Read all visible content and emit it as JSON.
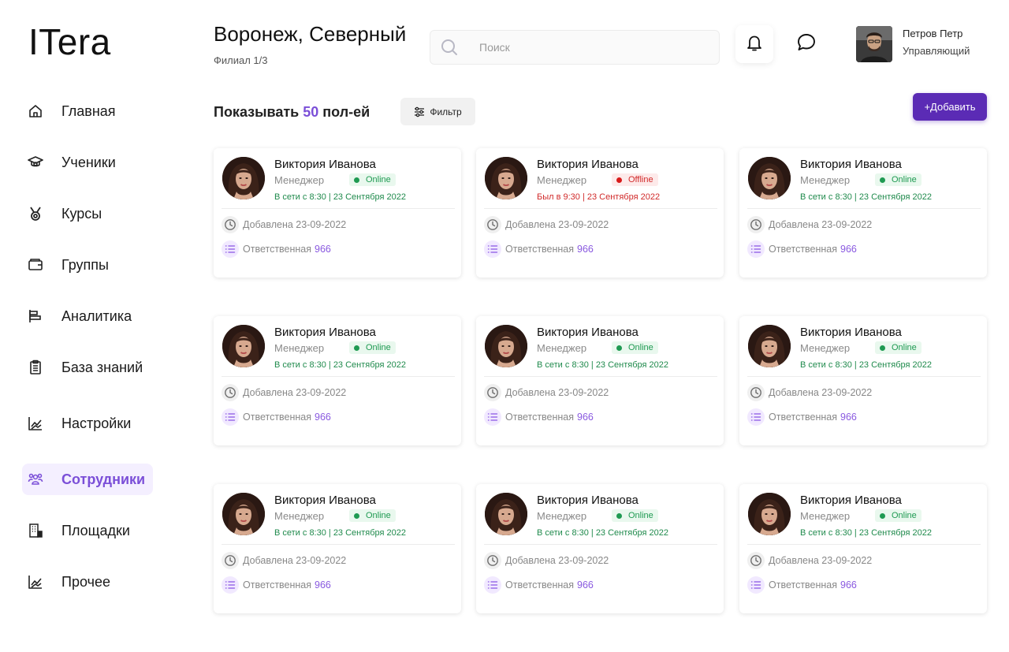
{
  "app": {
    "logo": "ITera"
  },
  "sidebar": {
    "items": [
      {
        "label": "Главная",
        "icon": "home-icon"
      },
      {
        "label": "Ученики",
        "icon": "graduation-cap-icon"
      },
      {
        "label": "Курсы",
        "icon": "medal-icon"
      },
      {
        "label": "Группы",
        "icon": "wallet-icon"
      },
      {
        "label": "Аналитика",
        "icon": "bar-chart-icon"
      },
      {
        "label": "База знаний",
        "icon": "clipboard-icon"
      },
      {
        "label": "Настройки",
        "icon": "line-chart-icon"
      },
      {
        "label": "Сотрудники",
        "icon": "people-icon",
        "active": true
      },
      {
        "label": "Площадки",
        "icon": "building-icon"
      },
      {
        "label": "Прочее",
        "icon": "line-chart-icon"
      }
    ]
  },
  "header": {
    "title": "Воронеж, Северный",
    "subtitle": "Филиал 1/3",
    "search_placeholder": "Поиск",
    "user": {
      "name": "Петров Петр",
      "role": "Управляющий"
    }
  },
  "toolbar": {
    "show_prefix": "Показывать",
    "show_count": "50",
    "show_suffix": "пол-ей",
    "filter_label": "Фильтр",
    "add_label": "+Добавить"
  },
  "colors": {
    "accent": "#7b4fd8",
    "add_button": "#5b2bb5",
    "online": "#1f9a52",
    "offline": "#d12a2a"
  },
  "cards": [
    {
      "name": "Виктория Иванова",
      "role": "Менеджер",
      "status": "Online",
      "status_kind": "online",
      "seen": "В сети с 8:30 | 23 Сентября 2022",
      "added": "Добавлена 23-09-2022",
      "resp_label": "Ответственная",
      "resp_value": "966"
    },
    {
      "name": "Виктория Иванова",
      "role": "Менеджер",
      "status": "Offline",
      "status_kind": "offline",
      "seen": "Был в 9:30 | 23 Сентября 2022",
      "added": "Добавлена 23-09-2022",
      "resp_label": "Ответственная",
      "resp_value": "966"
    },
    {
      "name": "Виктория Иванова",
      "role": "Менеджер",
      "status": "Online",
      "status_kind": "online",
      "seen": "В сети с 8:30 | 23 Сентября 2022",
      "added": "Добавлена 23-09-2022",
      "resp_label": "Ответственная",
      "resp_value": "966"
    },
    {
      "name": "Виктория Иванова",
      "role": "Менеджер",
      "status": "Online",
      "status_kind": "online",
      "seen": "В сети с 8:30 | 23 Сентября 2022",
      "added": "Добавлена 23-09-2022",
      "resp_label": "Ответственная",
      "resp_value": "966"
    },
    {
      "name": "Виктория Иванова",
      "role": "Менеджер",
      "status": "Online",
      "status_kind": "online",
      "seen": "В сети с 8:30 | 23 Сентября 2022",
      "added": "Добавлена 23-09-2022",
      "resp_label": "Ответственная",
      "resp_value": "966"
    },
    {
      "name": "Виктория Иванова",
      "role": "Менеджер",
      "status": "Online",
      "status_kind": "online",
      "seen": "В сети с 8:30 | 23 Сентября 2022",
      "added": "Добавлена 23-09-2022",
      "resp_label": "Ответственная",
      "resp_value": "966"
    },
    {
      "name": "Виктория Иванова",
      "role": "Менеджер",
      "status": "Online",
      "status_kind": "online",
      "seen": "В сети с 8:30 | 23 Сентября 2022",
      "added": "Добавлена 23-09-2022",
      "resp_label": "Ответственная",
      "resp_value": "966"
    },
    {
      "name": "Виктория Иванова",
      "role": "Менеджер",
      "status": "Online",
      "status_kind": "online",
      "seen": "В сети с 8:30 | 23 Сентября 2022",
      "added": "Добавлена 23-09-2022",
      "resp_label": "Ответственная",
      "resp_value": "966"
    },
    {
      "name": "Виктория Иванова",
      "role": "Менеджер",
      "status": "Online",
      "status_kind": "online",
      "seen": "В сети с 8:30 | 23 Сентября 2022",
      "added": "Добавлена 23-09-2022",
      "resp_label": "Ответственная",
      "resp_value": "966"
    }
  ]
}
